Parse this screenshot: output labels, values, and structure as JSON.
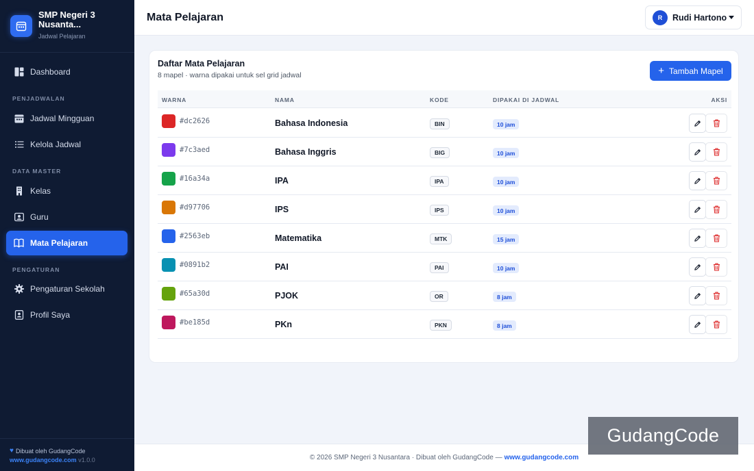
{
  "sidebar": {
    "brand_name": "SMP Negeri 3 Nusanta...",
    "brand_sub": "Jadwal Pelajaran",
    "items": [
      {
        "label": "Dashboard",
        "icon": "dashboard-icon"
      },
      {
        "label": "Jadwal Mingguan",
        "icon": "calendar-icon"
      },
      {
        "label": "Kelola Jadwal",
        "icon": "list-icon"
      },
      {
        "label": "Kelas",
        "icon": "building-icon"
      },
      {
        "label": "Guru",
        "icon": "person-badge-icon"
      },
      {
        "label": "Mata Pelajaran",
        "icon": "book-icon",
        "active": true
      },
      {
        "label": "Pengaturan Sekolah",
        "icon": "gear-icon"
      },
      {
        "label": "Profil Saya",
        "icon": "profile-icon"
      }
    ],
    "sections": [
      "PENJADWALAN",
      "DATA MASTER",
      "PENGATURAN"
    ],
    "footer_line1": "Dibuat oleh GudangCode",
    "footer_link": "www.gudangcode.com",
    "footer_version": "v1.0.0"
  },
  "header": {
    "title": "Mata Pelajaran",
    "user_initial": "R",
    "user_name": "Rudi Hartono"
  },
  "card": {
    "title": "Daftar Mata Pelajaran",
    "subtitle": "8 mapel · warna dipakai untuk sel grid jadwal",
    "add_button": "Tambah Mapel",
    "columns": [
      "WARNA",
      "NAMA",
      "KODE",
      "DIPAKAI DI JADWAL",
      "AKSI"
    ],
    "rows": [
      {
        "color": "#dc2626",
        "name": "Bahasa Indonesia",
        "code": "BIN",
        "hours": "10 jam"
      },
      {
        "color": "#7c3aed",
        "name": "Bahasa Inggris",
        "code": "BIG",
        "hours": "10 jam"
      },
      {
        "color": "#16a34a",
        "name": "IPA",
        "code": "IPA",
        "hours": "10 jam"
      },
      {
        "color": "#d97706",
        "name": "IPS",
        "code": "IPS",
        "hours": "10 jam"
      },
      {
        "color": "#2563eb",
        "name": "Matematika",
        "code": "MTK",
        "hours": "15 jam"
      },
      {
        "color": "#0891b2",
        "name": "PAI",
        "code": "PAI",
        "hours": "10 jam"
      },
      {
        "color": "#65a30d",
        "name": "PJOK",
        "code": "OR",
        "hours": "8 jam"
      },
      {
        "color": "#be185d",
        "name": "PKn",
        "code": "PKN",
        "hours": "8 jam"
      }
    ]
  },
  "footer": {
    "text": "© 2026 SMP Negeri 3 Nusantara · Dibuat oleh GudangCode —",
    "link": "www.gudangcode.com"
  },
  "watermark": "GudangCode",
  "colors": {
    "accent": "#2563eb",
    "sidebar_bg": "#0f1b33",
    "danger": "#dc2626"
  }
}
